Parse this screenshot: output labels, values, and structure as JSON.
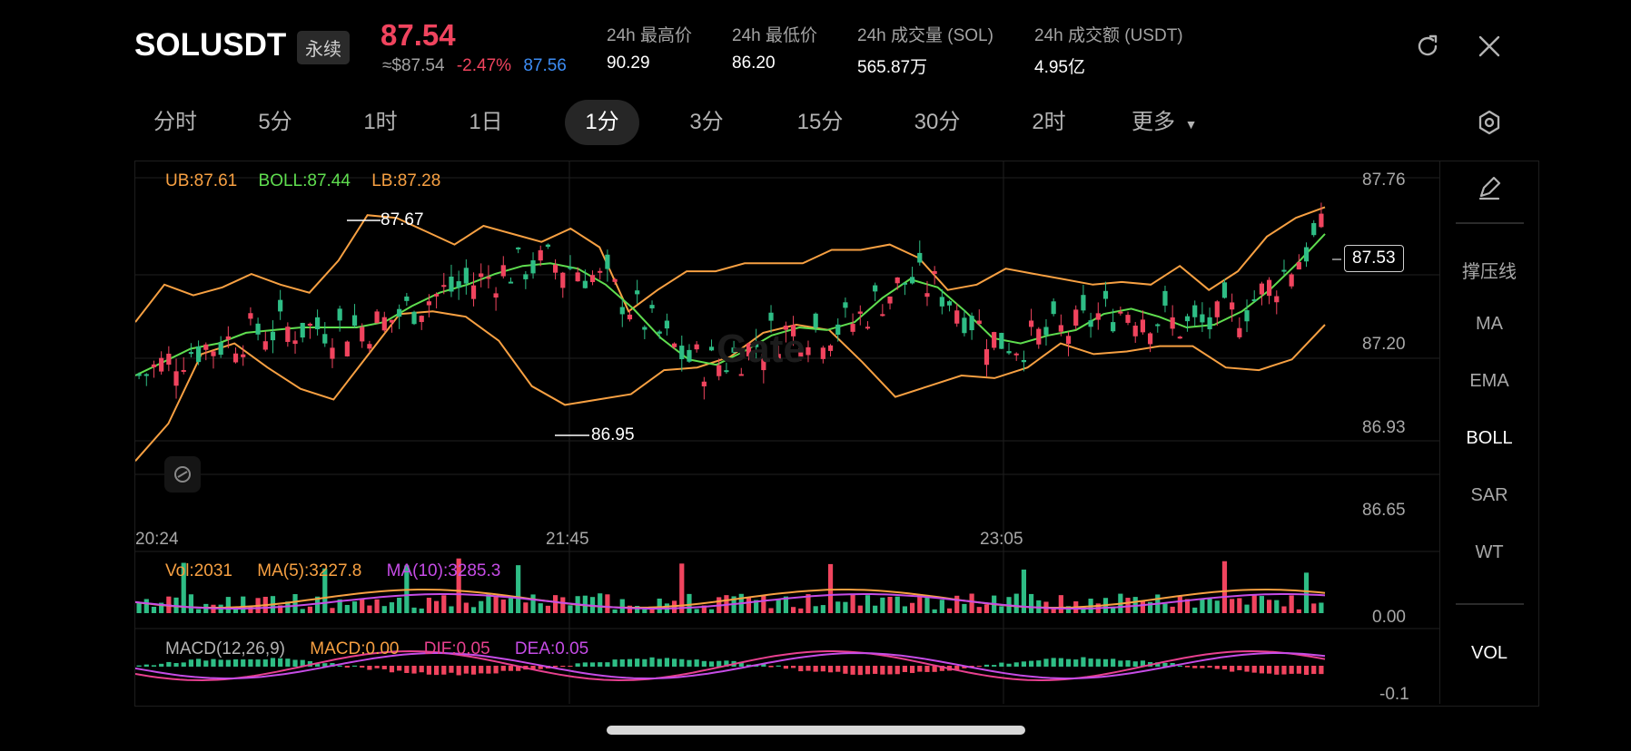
{
  "header": {
    "symbol": "SOLUSDT",
    "contract_type": "永续",
    "last_price": "87.54",
    "approx_usd": "≈$87.54",
    "change_pct": "-2.47%",
    "mark_price": "87.56",
    "stats": [
      {
        "label": "24h 最高价",
        "value": "90.29"
      },
      {
        "label": "24h 最低价",
        "value": "86.20"
      },
      {
        "label": "24h 成交量 (SOL)",
        "value": "565.87万"
      },
      {
        "label": "24h 成交额 (USDT)",
        "value": "4.95亿"
      }
    ]
  },
  "tabs": [
    {
      "label": "分时"
    },
    {
      "label": "5分"
    },
    {
      "label": "1时"
    },
    {
      "label": "1日"
    },
    {
      "label": "1分",
      "active": true
    },
    {
      "label": "3分"
    },
    {
      "label": "15分"
    },
    {
      "label": "30分"
    },
    {
      "label": "2时"
    },
    {
      "label": "更多"
    }
  ],
  "icons": {
    "refresh": "refresh-icon",
    "close": "close-icon",
    "settings": "settings-hexagon-icon",
    "draw": "pencil-icon",
    "watermark_toggle": "gate-logo-icon",
    "dropdown": "caret-down-icon"
  },
  "indicators_sidebar": [
    {
      "label": "撑压线"
    },
    {
      "label": "MA"
    },
    {
      "label": "EMA"
    },
    {
      "label": "BOLL",
      "active": true
    },
    {
      "label": "SAR"
    },
    {
      "label": "WT"
    },
    {
      "label": "VOL",
      "active": true
    }
  ],
  "colors": {
    "up": "#2ebd85",
    "down": "#f0445e",
    "ub": "#f7a042",
    "boll": "#5fdd4f",
    "ma10": "#c64ce6",
    "dif": "#e8408f",
    "blue": "#3d8df5"
  },
  "chart_data": [
    {
      "type": "candlestick",
      "interval": "1分",
      "legend": {
        "ub": "UB:87.61",
        "boll": "BOLL:87.44",
        "lb": "LB:87.28"
      },
      "y_ticks": [
        "87.76",
        "87.20",
        "86.93",
        "86.65"
      ],
      "x_ticks": [
        "20:24",
        "21:45",
        "23:05"
      ],
      "ylim": [
        86.65,
        87.76
      ],
      "high_label": "87.67",
      "low_label": "86.95",
      "current_price": "87.53",
      "watermark": "Gate",
      "boll_mid": [
        87.02,
        87.07,
        87.12,
        87.14,
        87.18,
        87.19,
        87.2,
        87.2,
        87.2,
        87.22,
        87.28,
        87.33,
        87.36,
        87.4,
        87.43,
        87.44,
        87.42,
        87.36,
        87.27,
        87.16,
        87.08,
        87.06,
        87.11,
        87.17,
        87.2,
        87.19,
        87.22,
        87.31,
        87.38,
        87.35,
        87.26,
        87.16,
        87.14,
        87.17,
        87.19,
        87.25,
        87.27,
        87.24,
        87.2,
        87.21,
        87.26,
        87.34,
        87.44,
        87.55
      ],
      "upper_band": [
        87.22,
        87.36,
        87.32,
        87.35,
        87.4,
        87.36,
        87.33,
        87.45,
        87.62,
        87.61,
        87.56,
        87.51,
        87.58,
        87.55,
        87.52,
        87.57,
        87.5,
        87.26,
        87.34,
        87.41,
        87.41,
        87.44,
        87.44,
        87.44,
        87.49,
        87.49,
        87.51,
        87.46,
        87.34,
        87.36,
        87.42,
        87.4,
        87.38,
        87.36,
        87.37,
        87.36,
        87.43,
        87.34,
        87.41,
        87.54,
        87.61,
        87.65
      ],
      "lower_band": [
        86.7,
        86.84,
        87.1,
        87.14,
        87.05,
        86.97,
        86.93,
        87.09,
        87.25,
        87.26,
        87.24,
        87.15,
        86.98,
        86.91,
        86.93,
        86.95,
        87.04,
        87.05,
        87.09,
        87.18,
        87.21,
        87.19,
        87.07,
        86.94,
        86.98,
        87.02,
        87.01,
        87.05,
        87.14,
        87.1,
        87.11,
        87.13,
        87.13,
        87.05,
        87.04,
        87.08,
        87.21
      ]
    },
    {
      "type": "bar",
      "name": "volume",
      "legend": {
        "vol": "Vol:2031",
        "ma5": "MA(5):3227.8",
        "ma10": "MA(10):3285.3"
      },
      "y_tick": "0.00"
    },
    {
      "type": "bar",
      "name": "macd",
      "legend": {
        "macd_label": "MACD(12,26,9)",
        "macd": "MACD:0.00",
        "dif": "DIF:0.05",
        "dea": "DEA:0.05"
      },
      "y_tick": "-0.1"
    }
  ]
}
